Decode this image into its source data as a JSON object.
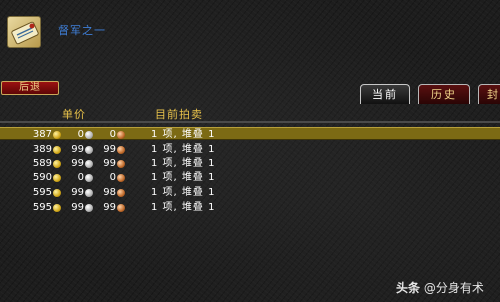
{
  "item": {
    "name": "督军之一",
    "icon": "scroll-item-icon"
  },
  "toolbar": {
    "back_label": "后退"
  },
  "tabs": [
    {
      "label": "当前",
      "active": true
    },
    {
      "label": "历史",
      "active": false
    },
    {
      "label": "封",
      "active": false
    }
  ],
  "columns": {
    "price": "单价",
    "auction": "目前拍卖"
  },
  "rows": [
    {
      "gold": "387",
      "silver": "0",
      "copper": "0",
      "auction": "1 项, 堆叠 1",
      "selected": true
    },
    {
      "gold": "389",
      "silver": "99",
      "copper": "99",
      "auction": "1 项, 堆叠 1",
      "selected": false
    },
    {
      "gold": "589",
      "silver": "99",
      "copper": "99",
      "auction": "1 项, 堆叠 1",
      "selected": false
    },
    {
      "gold": "590",
      "silver": "0",
      "copper": "0",
      "auction": "1 项, 堆叠 1",
      "selected": false
    },
    {
      "gold": "595",
      "silver": "99",
      "copper": "98",
      "auction": "1 项, 堆叠 1",
      "selected": false
    },
    {
      "gold": "595",
      "silver": "99",
      "copper": "99",
      "auction": "1 项, 堆叠 1",
      "selected": false
    }
  ],
  "watermark": {
    "brand": "头条",
    "handle": "@分身有术"
  },
  "colors": {
    "accent": "#e8c24a",
    "selected_row": "#7c6a14",
    "item_name": "#3f7fd9",
    "back_button": "#9c1212"
  }
}
